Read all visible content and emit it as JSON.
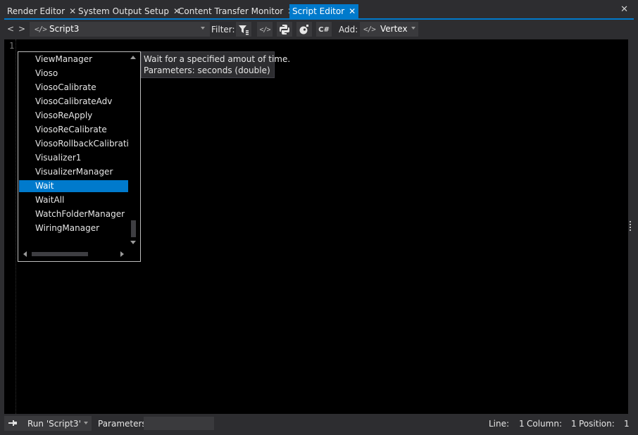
{
  "tabs": [
    {
      "label": "Render Editor",
      "active": false
    },
    {
      "label": "System Output Setup",
      "active": false
    },
    {
      "label": "Content Transfer Monitor",
      "active": false
    },
    {
      "label": "Script Editor",
      "active": true
    }
  ],
  "toolbar": {
    "back": "<",
    "forward": ">",
    "script_name": "Script3",
    "filter_label": "Filter:",
    "csharp_label": "C#",
    "add_label": "Add:",
    "add_value": "Vertex",
    "code_glyph": "</>"
  },
  "editor": {
    "line_number": "1"
  },
  "completion": {
    "items": [
      "ViewManager",
      "Vioso",
      "ViosoCalibrate",
      "ViosoCalibrateAdv",
      "ViosoReApply",
      "ViosoReCalibrate",
      "ViosoRollbackCalibration",
      "Visualizer1",
      "VisualizerManager",
      "Wait",
      "WaitAll",
      "WatchFolderManager",
      "WiringManager"
    ],
    "selected": "Wait"
  },
  "tooltip": {
    "line1": "Wait for a specified amout of time.",
    "line2": "Parameters: seconds (double)"
  },
  "status": {
    "run_label": "Run 'Script3'",
    "parameters_label": "Parameters:",
    "line_label": "Line:",
    "line_value": "1",
    "column_label": "Column:",
    "column_value": "1",
    "position_label": "Position:",
    "position_value": "1"
  },
  "colors": {
    "accent": "#007acc",
    "background": "#2d2d30",
    "editor": "#000000"
  }
}
